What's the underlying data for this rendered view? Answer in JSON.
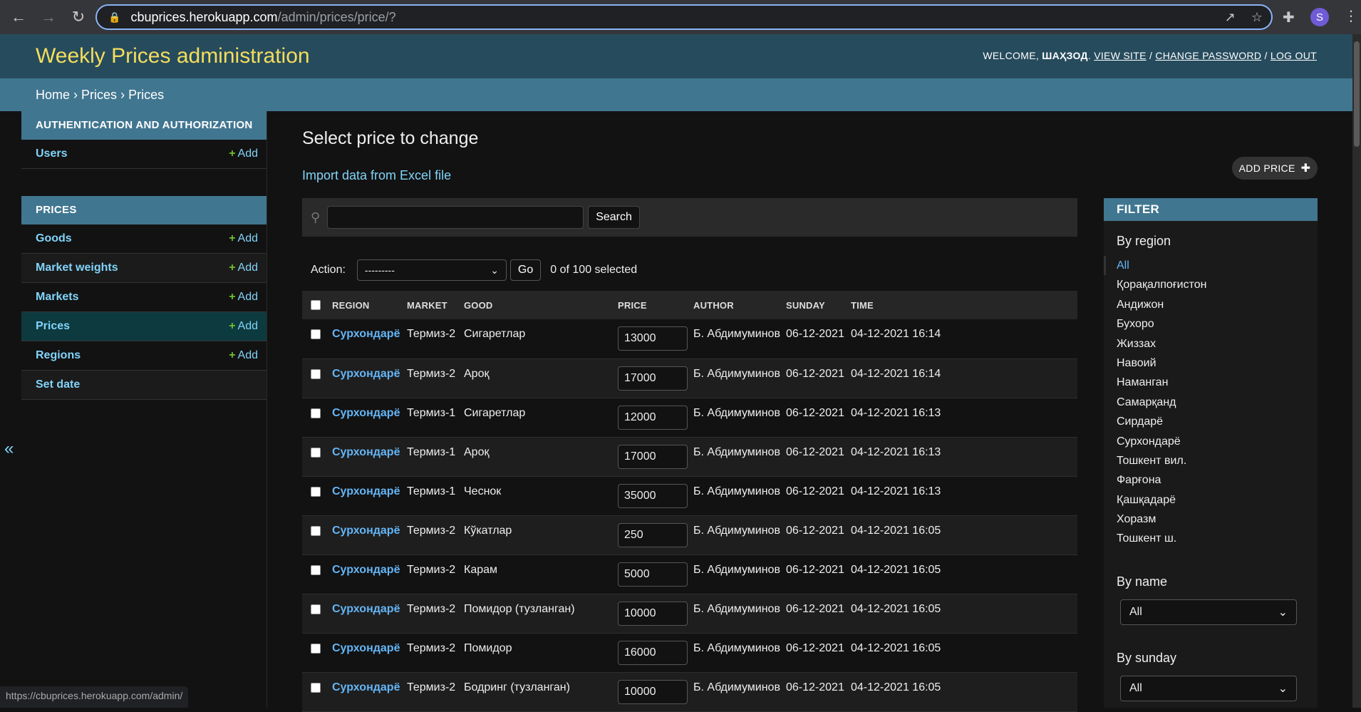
{
  "browser": {
    "url_host": "cbuprices.herokuapp.com",
    "url_path": "/admin/prices/price/?",
    "avatar_letter": "S",
    "status_url": "https://cbuprices.herokuapp.com/admin/"
  },
  "header": {
    "site_title": "Weekly Prices administration",
    "welcome": "WELCOME,",
    "username": "ШАҲЗОД",
    "view_site": "VIEW SITE",
    "change_password": "CHANGE PASSWORD",
    "log_out": "LOG OUT",
    "sep": "/"
  },
  "breadcrumbs": {
    "home": "Home",
    "app": "Prices",
    "model": "Prices",
    "sep": "›"
  },
  "sidebar": {
    "collapse_glyph": "«",
    "apps": [
      {
        "caption": "AUTHENTICATION AND AUTHORIZATION",
        "models": [
          {
            "name": "Users",
            "add": "Add"
          }
        ]
      },
      {
        "caption": "PRICES",
        "models": [
          {
            "name": "Goods",
            "add": "Add"
          },
          {
            "name": "Market weights",
            "add": "Add"
          },
          {
            "name": "Markets",
            "add": "Add"
          },
          {
            "name": "Prices",
            "add": "Add"
          },
          {
            "name": "Regions",
            "add": "Add"
          },
          {
            "name": "Set date",
            "add": ""
          }
        ]
      }
    ]
  },
  "content": {
    "title": "Select price to change",
    "import_link": "Import data from Excel file",
    "add_button": "ADD PRICE",
    "search_button": "Search",
    "search_value": "",
    "action_label": "Action:",
    "action_selected": "---------",
    "go_button": "Go",
    "selected_count": "0 of 100 selected"
  },
  "table": {
    "headers": [
      "REGION",
      "MARKET",
      "GOOD",
      "PRICE",
      "AUTHOR",
      "SUNDAY",
      "TIME"
    ],
    "rows": [
      {
        "region": "Сурхондарё",
        "market": "Термиз-2",
        "good": "Сигаретлар",
        "price": "13000",
        "author": "Б. Абдимуминов",
        "sunday": "06-12-2021",
        "time": "04-12-2021 16:14"
      },
      {
        "region": "Сурхондарё",
        "market": "Термиз-2",
        "good": "Ароқ",
        "price": "17000",
        "author": "Б. Абдимуминов",
        "sunday": "06-12-2021",
        "time": "04-12-2021 16:14"
      },
      {
        "region": "Сурхондарё",
        "market": "Термиз-1",
        "good": "Сигаретлар",
        "price": "12000",
        "author": "Б. Абдимуминов",
        "sunday": "06-12-2021",
        "time": "04-12-2021 16:13"
      },
      {
        "region": "Сурхондарё",
        "market": "Термиз-1",
        "good": "Ароқ",
        "price": "17000",
        "author": "Б. Абдимуминов",
        "sunday": "06-12-2021",
        "time": "04-12-2021 16:13"
      },
      {
        "region": "Сурхондарё",
        "market": "Термиз-1",
        "good": "Чеснок",
        "price": "35000",
        "author": "Б. Абдимуминов",
        "sunday": "06-12-2021",
        "time": "04-12-2021 16:13"
      },
      {
        "region": "Сурхондарё",
        "market": "Термиз-2",
        "good": "Кўкатлар",
        "price": "250",
        "author": "Б. Абдимуминов",
        "sunday": "06-12-2021",
        "time": "04-12-2021 16:05"
      },
      {
        "region": "Сурхондарё",
        "market": "Термиз-2",
        "good": "Карам",
        "price": "5000",
        "author": "Б. Абдимуминов",
        "sunday": "06-12-2021",
        "time": "04-12-2021 16:05"
      },
      {
        "region": "Сурхондарё",
        "market": "Термиз-2",
        "good": "Помидор (тузланган)",
        "price": "10000",
        "author": "Б. Абдимуминов",
        "sunday": "06-12-2021",
        "time": "04-12-2021 16:05"
      },
      {
        "region": "Сурхондарё",
        "market": "Термиз-2",
        "good": "Помидор",
        "price": "16000",
        "author": "Б. Абдимуминов",
        "sunday": "06-12-2021",
        "time": "04-12-2021 16:05"
      },
      {
        "region": "Сурхондарё",
        "market": "Термиз-2",
        "good": "Бодринг (тузланган)",
        "price": "10000",
        "author": "Б. Абдимуминов",
        "sunday": "06-12-2021",
        "time": "04-12-2021 16:05"
      }
    ]
  },
  "filter": {
    "caption": "FILTER",
    "by_region_title": "By region",
    "regions": [
      "All",
      "Қорақалпоғистон",
      "Андижон",
      "Бухоро",
      "Жиззах",
      "Навоий",
      "Наманган",
      "Самарқанд",
      "Сирдарё",
      "Сурхондарё",
      "Тошкент вил.",
      "Фарғона",
      "Қашқадарё",
      "Хоразм",
      "Тошкент ш."
    ],
    "by_name_title": "By name",
    "by_name_value": "All",
    "by_sunday_title": "By sunday",
    "by_sunday_value": "All"
  },
  "colors": {
    "header_bg": "#264b5d",
    "title_yellow": "#f5dd5d",
    "breadcrumb_bg": "#417690",
    "link_blue": "#81d4fa",
    "add_green": "#70bf2b"
  }
}
